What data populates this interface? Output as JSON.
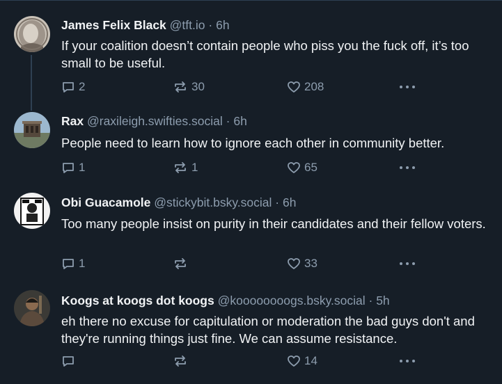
{
  "posts": [
    {
      "name": "James Felix Black",
      "handle": "@tft.io",
      "time": "6h",
      "text": "If your coalition doesn’t contain people who piss you the fuck off, it’s too small to be useful.",
      "replies": "2",
      "reposts": "30",
      "likes": "208",
      "avatar_color": "#bfb7ad"
    },
    {
      "name": "Rax",
      "handle": "@raxileigh.swifties.social",
      "time": "6h",
      "text": "People need to learn how to ignore each other in community better.",
      "replies": "1",
      "reposts": "1",
      "likes": "65",
      "avatar_color": "#8aa7c0"
    },
    {
      "name": "Obi Guacamole",
      "handle": "@stickybit.bsky.social",
      "time": "6h",
      "text": "Too many people insist on purity in their candidates and their fellow voters.",
      "replies": "1",
      "reposts": "",
      "likes": "33",
      "avatar_color": "#e6e6e6"
    },
    {
      "name": "Koogs at koogs dot koogs",
      "handle": "@koooooooogs.bsky.social",
      "time": "5h",
      "text": "eh there no excuse for capitulation or moderation the bad guys don't and they're running things just fine.  We can assume resistance.",
      "replies": "",
      "reposts": "",
      "likes": "14",
      "avatar_color": "#5b4a3c"
    }
  ],
  "separator": "·",
  "colors": {
    "background": "#161e27",
    "text": "#f1f3f5",
    "muted": "#8d9dae",
    "thread_line": "#2e4052"
  },
  "icons": {
    "reply": "speech-bubble-icon",
    "repost": "repost-arrows-icon",
    "like": "heart-outline-icon",
    "more": "ellipsis-icon"
  }
}
